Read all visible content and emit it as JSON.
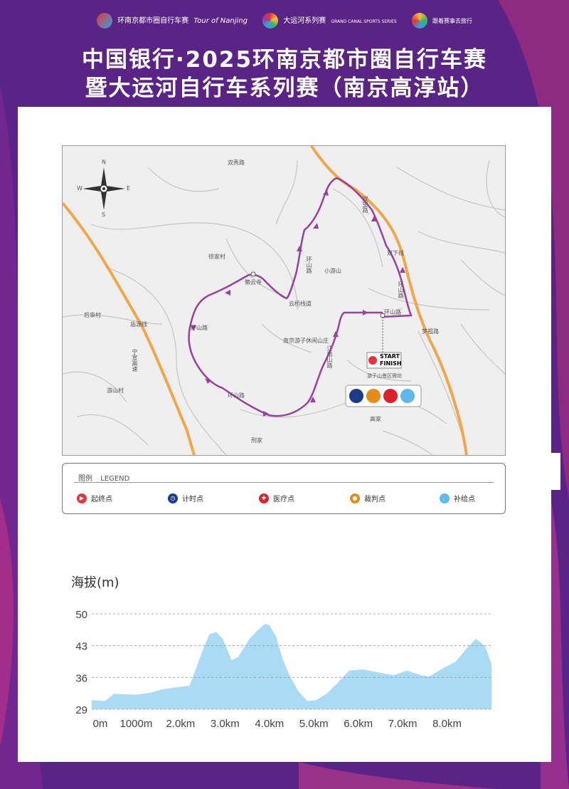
{
  "header": {
    "logo1": "环南京都市圈自行车赛",
    "logo1_sub": "Tour of Nanjing",
    "logo2": "大运河系列赛",
    "logo2_sub": "GRAND CANAL SPORTS SERIES",
    "logo3": "跟着赛事去旅行",
    "title_line1": "中国银行·2025环南京都市圈自行车赛",
    "title_line2": "暨大运河自行车系列赛（南京高淳站）"
  },
  "map": {
    "labels": {
      "shuangxiu": "双秀路",
      "xujia": "徐家村",
      "lanyun": "懒云寺",
      "yunqiao": "云桥栈道",
      "huanshan1": "环山路",
      "xiaoyoushan": "小游山",
      "shuangxia": "双下线",
      "huanshan2": "环山路",
      "shuangwang": "双望路",
      "houxiao": "后枭村",
      "linyuan": "庙源线",
      "huanshan3": "环山路",
      "resort": "南京游子休闲山庄",
      "huanshan4": "环山路",
      "jiangnan": "江南山路",
      "mengzi": "梦祖路",
      "ningxuan": "宁宣高速",
      "youshan": "游山村",
      "huanshan5": "环山路",
      "lijia": "刑家",
      "gaojia": "高家",
      "scenic": "游子山景区牌坊"
    },
    "start": "START",
    "finish": "FINISH",
    "compass": {
      "n": "N",
      "s": "S",
      "e": "E",
      "w": "W"
    }
  },
  "legend": {
    "title_cn": "图例",
    "title_en": "LEGEND",
    "items": [
      {
        "label": "起终点",
        "icon": "start-finish-icon",
        "color": "#e8333c"
      },
      {
        "label": "计时点",
        "icon": "timing-icon",
        "color": "#1e3a8a"
      },
      {
        "label": "医疗点",
        "icon": "medical-icon",
        "color": "#d9232d"
      },
      {
        "label": "裁判点",
        "icon": "referee-icon",
        "color": "#e88a1a"
      },
      {
        "label": "补给点",
        "icon": "supply-icon",
        "color": "#5fb8e8"
      }
    ]
  },
  "elevation": {
    "title": "海拔(m)",
    "chart_data": {
      "type": "area",
      "title": "海拔(m)",
      "xlabel": "",
      "ylabel": "海拔(m)",
      "ylim": [
        29,
        50
      ],
      "xlim": [
        0,
        9.0
      ],
      "y_ticks": [
        "50",
        "43",
        "36",
        "29"
      ],
      "x_ticks": [
        "0m",
        "1000m",
        "2.0km",
        "3.0km",
        "4.0km",
        "5.0km",
        "6.0km",
        "7.0km",
        "8.0km"
      ],
      "x_tick_values": [
        0,
        1.0,
        2.0,
        3.0,
        4.0,
        5.0,
        6.0,
        7.0,
        8.0
      ],
      "color": "#a9dbf5",
      "x": [
        0,
        0.3,
        0.5,
        1.0,
        1.3,
        1.6,
        2.2,
        2.35,
        2.5,
        2.65,
        2.8,
        2.95,
        3.15,
        3.3,
        3.55,
        3.75,
        3.9,
        4.0,
        4.15,
        4.3,
        4.45,
        4.65,
        4.85,
        5.05,
        5.3,
        5.55,
        5.8,
        6.1,
        6.4,
        6.8,
        7.1,
        7.4,
        7.6,
        7.9,
        8.2,
        8.45,
        8.65,
        8.85,
        9.0
      ],
      "y": [
        31,
        30.8,
        32.4,
        32.2,
        32.6,
        33.4,
        34.2,
        38,
        42,
        45.5,
        46,
        44.5,
        39.8,
        40.5,
        44.5,
        46.5,
        47.8,
        47.5,
        45,
        40,
        36.5,
        33,
        30.8,
        31,
        32.5,
        35,
        37.5,
        37.8,
        37.2,
        36.5,
        37.5,
        36.5,
        36.2,
        38,
        39.5,
        42.5,
        44.5,
        43,
        39
      ]
    }
  }
}
